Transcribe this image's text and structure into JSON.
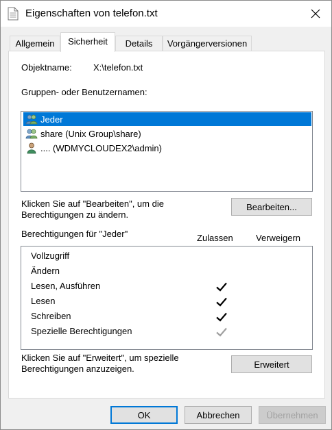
{
  "window": {
    "title": "Eigenschaften von telefon.txt"
  },
  "tabs": [
    {
      "label": "Allgemein"
    },
    {
      "label": "Sicherheit"
    },
    {
      "label": "Details"
    },
    {
      "label": "Vorgängerversionen"
    }
  ],
  "object": {
    "label": "Objektname:",
    "value": "X:\\telefon.txt"
  },
  "groups": {
    "label": "Gruppen- oder Benutzernamen:",
    "items": [
      {
        "name": "Jeder",
        "icon": "group-users-icon",
        "selected": true
      },
      {
        "name": "share (Unix Group\\share)",
        "icon": "group-users-icon",
        "selected": false
      },
      {
        "name": ".... (WDMYCLOUDEX2\\admin)",
        "icon": "single-user-icon",
        "selected": false
      }
    ]
  },
  "edit": {
    "hint_line1": "Klicken Sie auf \"Bearbeiten\", um die",
    "hint_line2": "Berechtigungen zu ändern.",
    "button": "Bearbeiten..."
  },
  "permissions": {
    "title": "Berechtigungen für \"Jeder\"",
    "col_allow": "Zulassen",
    "col_deny": "Verweigern",
    "rows": [
      {
        "name": "Vollzugriff",
        "allow": "none"
      },
      {
        "name": "Ändern",
        "allow": "none"
      },
      {
        "name": "Lesen, Ausführen",
        "allow": "checked"
      },
      {
        "name": "Lesen",
        "allow": "checked"
      },
      {
        "name": "Schreiben",
        "allow": "checked"
      },
      {
        "name": "Spezielle Berechtigungen",
        "allow": "checked-inherited"
      }
    ]
  },
  "advanced": {
    "hint_line1": "Klicken Sie auf \"Erweitert\", um spezielle",
    "hint_line2": "Berechtigungen anzuzeigen.",
    "button": "Erweitert"
  },
  "footer": {
    "ok": "OK",
    "cancel": "Abbrechen",
    "apply": "Übernehmen"
  },
  "colors": {
    "selection": "#0078d7",
    "check": "#000000",
    "check_inherited": "#a0a0a0"
  }
}
